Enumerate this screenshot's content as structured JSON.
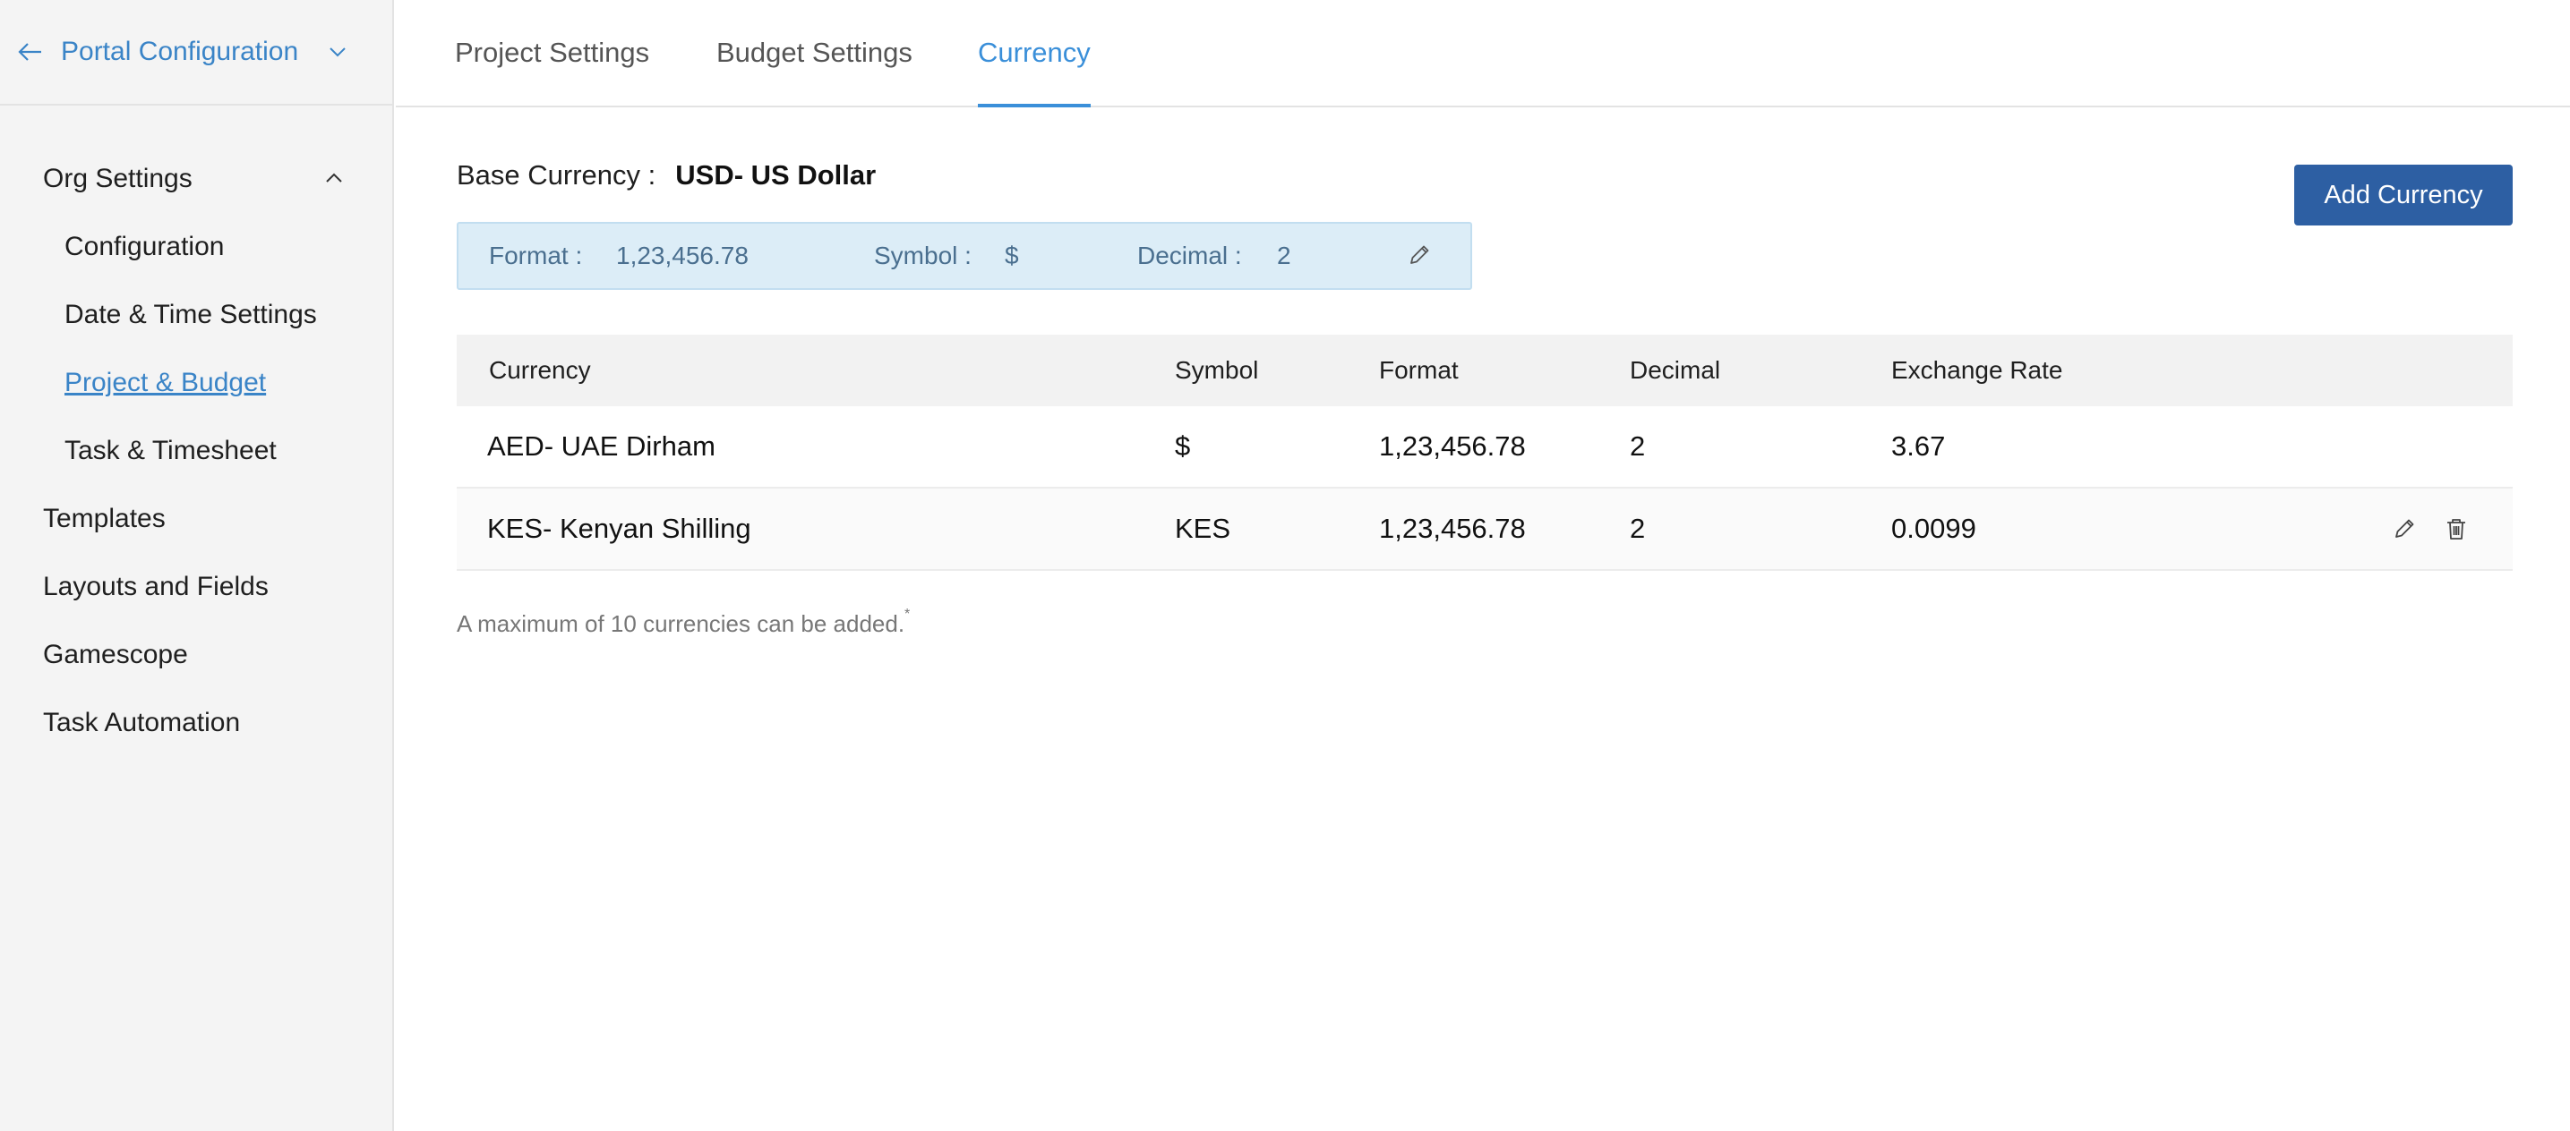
{
  "sidebar": {
    "header_title": "Portal Configuration",
    "items": [
      {
        "label": "Org Settings"
      },
      {
        "label": "Configuration"
      },
      {
        "label": "Date & Time Settings"
      },
      {
        "label": "Project & Budget"
      },
      {
        "label": "Task & Timesheet"
      },
      {
        "label": "Templates"
      },
      {
        "label": "Layouts and Fields"
      },
      {
        "label": "Gamescope"
      },
      {
        "label": "Task Automation"
      }
    ]
  },
  "tabs": [
    {
      "label": "Project Settings"
    },
    {
      "label": "Budget Settings"
    },
    {
      "label": "Currency"
    }
  ],
  "base_currency": {
    "label": "Base Currency :",
    "value": "USD- US Dollar",
    "format_label": "Format :",
    "format_value": "1,23,456.78",
    "symbol_label": "Symbol :",
    "symbol_value": "$",
    "decimal_label": "Decimal :",
    "decimal_value": "2"
  },
  "add_button_label": "Add Currency",
  "table": {
    "headers": [
      "Currency",
      "Symbol",
      "Format",
      "Decimal",
      "Exchange Rate"
    ],
    "rows": [
      {
        "currency": "AED- UAE Dirham",
        "symbol": "$",
        "format": "1,23,456.78",
        "decimal": "2",
        "rate": "3.67"
      },
      {
        "currency": "KES- Kenyan Shilling",
        "symbol": "KES",
        "format": "1,23,456.78",
        "decimal": "2",
        "rate": "0.0099"
      }
    ]
  },
  "note": "A maximum of 10 currencies can be added.",
  "note_marker": "*",
  "colors": {
    "accent": "#3a8fd9",
    "button": "#2d5fa3",
    "format_bg": "#dcedf7"
  }
}
